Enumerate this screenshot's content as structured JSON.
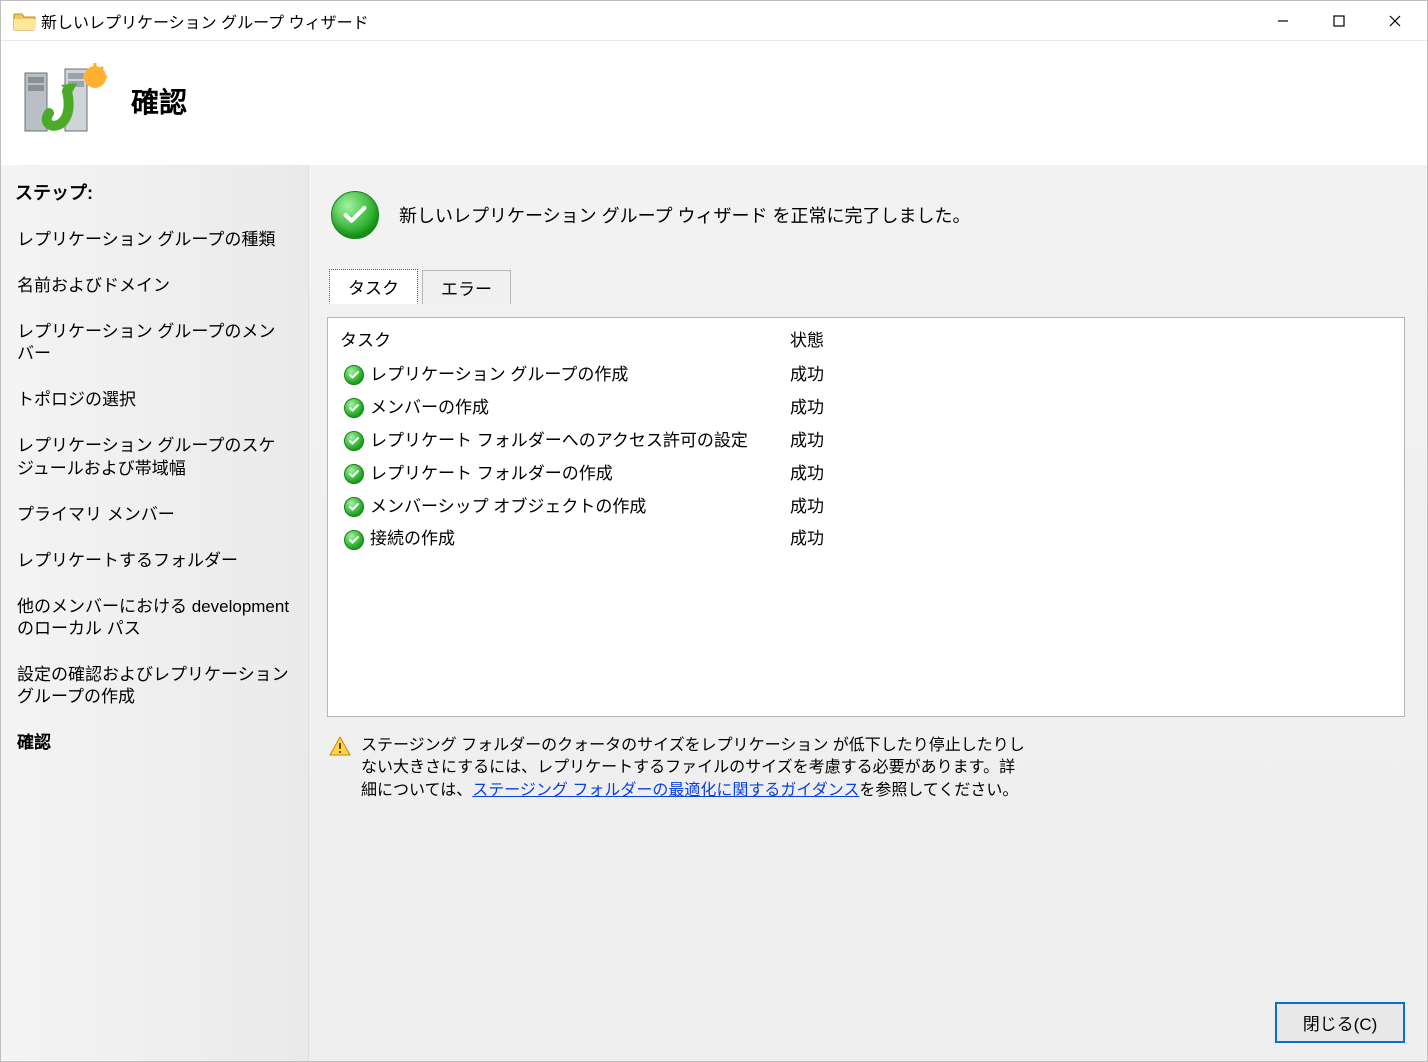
{
  "window": {
    "title": "新しいレプリケーション グループ ウィザード"
  },
  "header": {
    "page_title": "確認"
  },
  "sidebar": {
    "heading": "ステップ:",
    "items": [
      "レプリケーション グループの種類",
      "名前およびドメイン",
      "レプリケーション グループのメンバー",
      "トポロジの選択",
      "レプリケーション グループのスケジュールおよび帯域幅",
      "プライマリ メンバー",
      "レプリケートするフォルダー",
      "他のメンバーにおける development のローカル パス",
      "設定の確認およびレプリケーション グループの作成",
      "確認"
    ],
    "active_index": 9
  },
  "success_message": "新しいレプリケーション グループ ウィザード を正常に完了しました。",
  "tabs": [
    {
      "label": "タスク",
      "active": true
    },
    {
      "label": "エラー",
      "active": false
    }
  ],
  "table": {
    "columns": {
      "task": "タスク",
      "status": "状態"
    },
    "rows": [
      {
        "task": "レプリケーション グループの作成",
        "status": "成功"
      },
      {
        "task": "メンバーの作成",
        "status": "成功"
      },
      {
        "task": "レプリケート フォルダーへのアクセス許可の設定",
        "status": "成功"
      },
      {
        "task": "レプリケート フォルダーの作成",
        "status": "成功"
      },
      {
        "task": "メンバーシップ オブジェクトの作成",
        "status": "成功"
      },
      {
        "task": "接続の作成",
        "status": "成功"
      }
    ]
  },
  "warning": {
    "pre_link": "ステージング フォルダーのクォータのサイズをレプリケーション が低下したり停止したりしない大きさにするには、レプリケートするファイルのサイズを考慮する必要があります。詳細については、",
    "link": "ステージング フォルダーの最適化に関するガイダンス",
    "post_link": "を参照してください。"
  },
  "footer": {
    "close_label": "閉じる(C)"
  }
}
